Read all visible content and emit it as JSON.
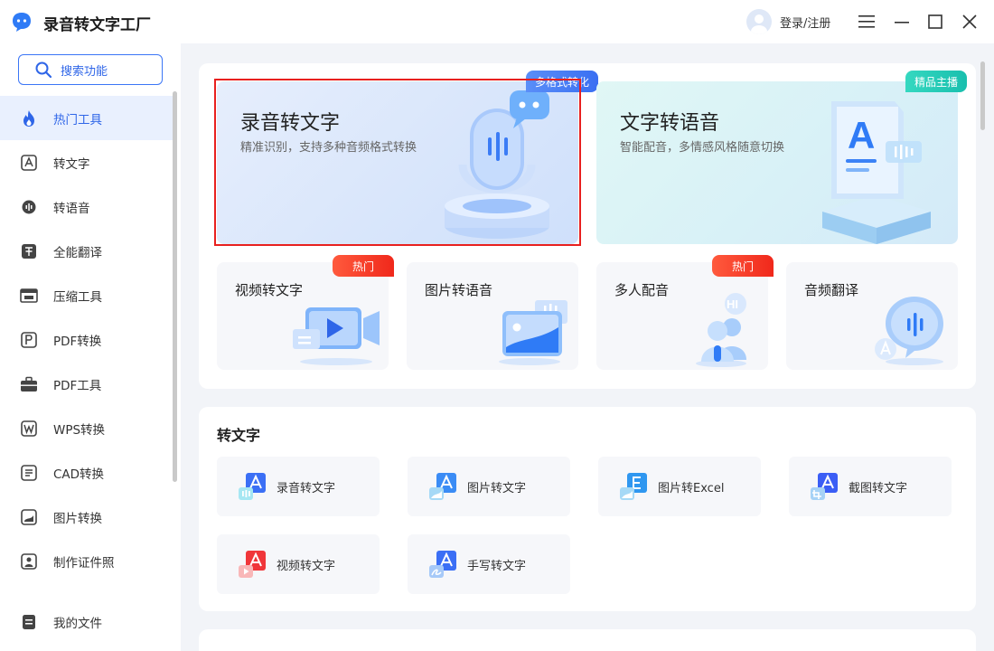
{
  "app": {
    "title": "录音转文字工厂",
    "login_label": "登录/注册"
  },
  "sidebar": {
    "search_label": "搜索功能",
    "items": [
      {
        "label": "热门工具",
        "icon": "flame-icon",
        "active": true
      },
      {
        "label": "转文字",
        "icon": "letter-a-icon"
      },
      {
        "label": "转语音",
        "icon": "voice-icon"
      },
      {
        "label": "全能翻译",
        "icon": "translate-icon"
      },
      {
        "label": "压缩工具",
        "icon": "compress-icon"
      },
      {
        "label": "PDF转换",
        "icon": "pdf-icon"
      },
      {
        "label": "PDF工具",
        "icon": "toolbox-icon"
      },
      {
        "label": "WPS转换",
        "icon": "wps-icon"
      },
      {
        "label": "CAD转换",
        "icon": "cad-icon"
      },
      {
        "label": "图片转换",
        "icon": "image-icon"
      },
      {
        "label": "制作证件照",
        "icon": "id-photo-icon"
      }
    ],
    "my_files_label": "我的文件"
  },
  "hot": {
    "hero": [
      {
        "title": "录音转文字",
        "subtitle": "精准识别，支持多种音频格式转换",
        "tag": "多格式转化"
      },
      {
        "title": "文字转语音",
        "subtitle": "智能配音，多情感风格随意切换",
        "tag": "精品主播"
      }
    ],
    "tools": [
      {
        "title": "视频转文字",
        "tag": "热门"
      },
      {
        "title": "图片转语音",
        "tag": ""
      },
      {
        "title": "多人配音",
        "tag": "热门"
      },
      {
        "title": "音频翻译",
        "tag": ""
      }
    ]
  },
  "to_text": {
    "title": "转文字",
    "items": [
      {
        "label": "录音转文字",
        "icon_letter": "A"
      },
      {
        "label": "图片转文字",
        "icon_letter": "A"
      },
      {
        "label": "图片转Excel",
        "icon_letter": "E"
      },
      {
        "label": "截图转文字",
        "icon_letter": "A"
      },
      {
        "label": "视频转文字",
        "icon_letter": "A"
      },
      {
        "label": "手写转文字",
        "icon_letter": "A"
      }
    ]
  },
  "art": {
    "hi_badge": "HI",
    "letter_a": "A"
  },
  "colors": {
    "accent": "#2f66e8",
    "hot": "#f0281b",
    "teal": "#25cbb5",
    "selection": "#e8201f"
  }
}
